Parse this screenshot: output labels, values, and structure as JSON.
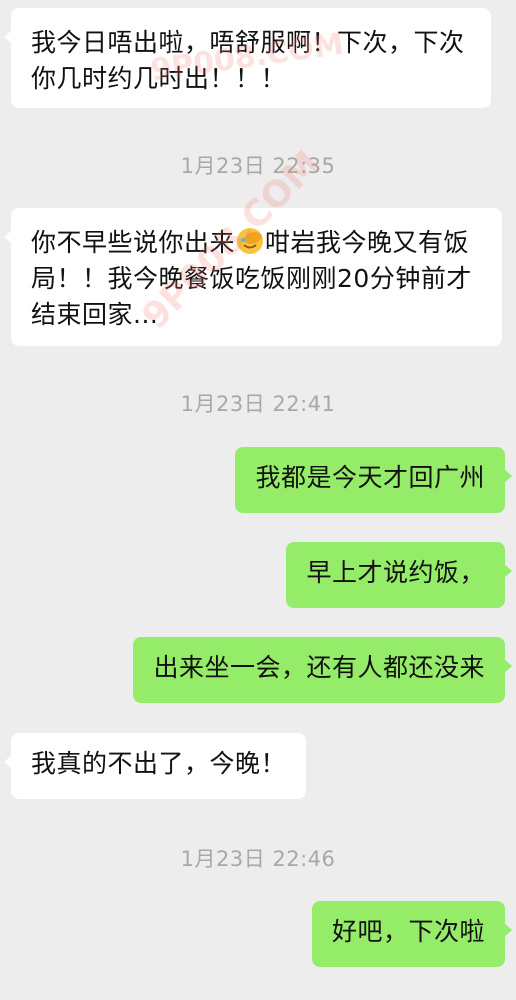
{
  "messages": [
    {
      "dir": "in",
      "text": "我今日唔出啦，唔舒服啊！下次，下次你几时约几时出！！！"
    },
    {
      "timestamp": "1月23日 22:35"
    },
    {
      "dir": "in",
      "text_a": "你不早些说你出来",
      "emoji": "face-with-hand-over-eyes-icon",
      "text_b": "咁岩我今晚又有饭局！！我今晚餐饭吃饭刚刚20分钟前才结束回家..."
    },
    {
      "timestamp": "1月23日 22:41"
    },
    {
      "dir": "out",
      "text": "我都是今天才回广州"
    },
    {
      "dir": "out",
      "text": "早上才说约饭，"
    },
    {
      "dir": "out",
      "text": "出来坐一会，还有人都还没来"
    },
    {
      "dir": "in",
      "text": "我真的不出了，今晚！"
    },
    {
      "timestamp": "1月23日 22:46"
    },
    {
      "dir": "out",
      "text": "好吧，下次啦"
    }
  ],
  "watermark": {
    "text_1": "9P008.COM",
    "text_2": "9P008.COM"
  },
  "colors": {
    "background": "#ededed",
    "incoming_bubble": "#ffffff",
    "outgoing_bubble": "#95ec69",
    "timestamp_text": "#a8a8a8"
  }
}
